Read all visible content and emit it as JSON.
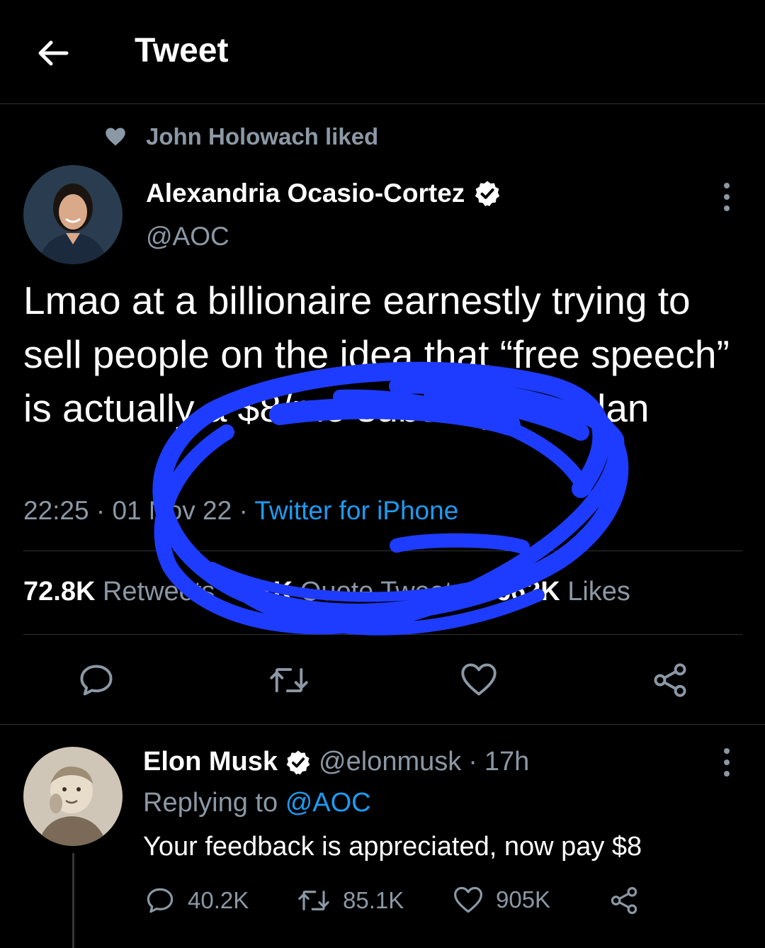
{
  "header": {
    "title": "Tweet"
  },
  "social_context": {
    "text": "John Holowach liked"
  },
  "tweet": {
    "author_name": "Alexandria Ocasio-Cortez",
    "author_handle": "@AOC",
    "verified": true,
    "text": "Lmao at a billionaire earnestly trying to sell people on the idea that “free speech” is actually a $8/mo subscription plan",
    "time": "22:25",
    "date": "01 Nov 22",
    "source": "Twitter for iPhone",
    "stats": {
      "retweets_count": "72.8K",
      "retweets_label": "Retweets",
      "quotes_count": "11K",
      "quotes_label": "Quote Tweets",
      "likes_count": "662K",
      "likes_label": "Likes"
    }
  },
  "reply": {
    "author_name": "Elon Musk",
    "author_handle": "@elonmusk",
    "time": "17h",
    "replying_prefix": "Replying to",
    "replying_to": "@AOC",
    "text": "Your feedback is appreciated, now pay $8",
    "replies": "40.2K",
    "retweets": "85.1K",
    "likes": "905K"
  },
  "colors": {
    "background": "#000000",
    "accent": "#1d9bf0",
    "secondary_text": "#8b98a5",
    "annotation": "#1e3cff"
  },
  "icons": [
    "back-arrow-icon",
    "heart-icon",
    "verified-badge-icon",
    "more-icon",
    "reply-icon",
    "retweet-icon",
    "like-icon",
    "share-icon"
  ]
}
